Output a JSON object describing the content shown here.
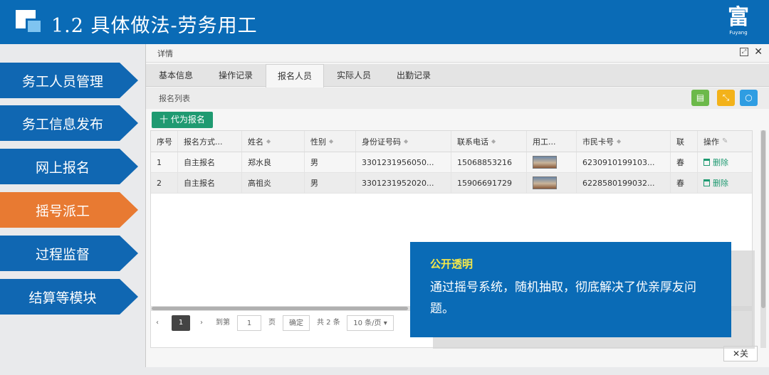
{
  "slide": {
    "title": "1.2 具体做法-劳务用工"
  },
  "colors": {
    "header_blue": "#0a6bb6",
    "nav_blue": "#1067b2",
    "nav_active_orange": "#e87a32",
    "action_green": "#1f9a71",
    "highlight_yellow": "#f6e94a"
  },
  "nav": {
    "items": [
      {
        "label": "务工人员管理",
        "active": false
      },
      {
        "label": "务工信息发布",
        "active": false
      },
      {
        "label": "网上报名",
        "active": false
      },
      {
        "label": "摇号派工",
        "active": true
      },
      {
        "label": "过程监督",
        "active": false
      },
      {
        "label": "结算等模块",
        "active": false
      }
    ]
  },
  "dialog": {
    "title": "详情",
    "tabs": [
      {
        "label": "基本信息",
        "active": false
      },
      {
        "label": "操作记录",
        "active": false
      },
      {
        "label": "报名人员",
        "active": true
      },
      {
        "label": "实际人员",
        "active": false
      },
      {
        "label": "出勤记录",
        "active": false
      }
    ],
    "list_title": "报名列表",
    "proxy_button": "十 代为报名",
    "close_button": "✕关"
  },
  "table": {
    "columns": [
      "序号",
      "报名方式...",
      "姓名",
      "性别",
      "身份证号码",
      "联系电话",
      "用工...",
      "市民卡号",
      "联",
      "操作"
    ],
    "rows": [
      {
        "index": "1",
        "method": "自主报名",
        "name": "郑水良",
        "gender": "男",
        "id_number": "3301231956050...",
        "phone": "15068853216",
        "card_no": "6230910199103...",
        "contact": "春",
        "action": "删除"
      },
      {
        "index": "2",
        "method": "自主报名",
        "name": "高祖炎",
        "gender": "男",
        "id_number": "3301231952020...",
        "phone": "15906691729",
        "card_no": "6228580199032...",
        "contact": "春",
        "action": "删除"
      }
    ]
  },
  "pager": {
    "current_page": "1",
    "goto_label": "到第",
    "goto_value": "1",
    "page_unit": "页",
    "confirm": "确定",
    "total": "共 2 条",
    "page_size": "10 条/页"
  },
  "callout": {
    "title": "公开透明",
    "body": "通过摇号系统，随机抽取，彻底解决了优亲厚友问题。"
  },
  "icons": {
    "logo": "square-logo-icon",
    "brand": "brand-logo-icon",
    "maximize": "maximize-icon",
    "close": "close-icon",
    "export": "export-icon",
    "expand": "expand-icon",
    "refresh": "refresh-icon",
    "delete": "trash-icon",
    "settings": "wrench-icon"
  }
}
